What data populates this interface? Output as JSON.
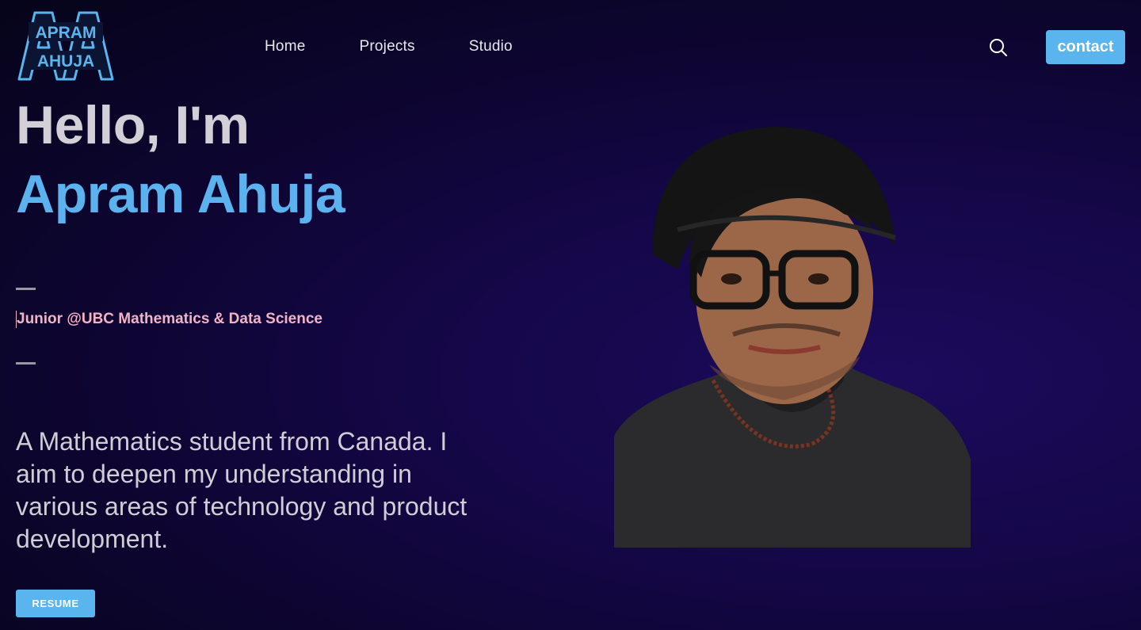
{
  "logo": {
    "line1": "APRAM",
    "line2": "AHUJA",
    "color": "#5ab4ee"
  },
  "nav": {
    "items": [
      {
        "label": "Home"
      },
      {
        "label": "Projects"
      },
      {
        "label": "Studio"
      }
    ]
  },
  "header": {
    "search_icon": "search-icon",
    "contact_label": "contact"
  },
  "hero": {
    "greeting": "Hello, I'm",
    "name": "Apram Ahuja",
    "subtitle": "Junior @UBC Mathematics & Data Science",
    "bio": "A Mathematics student from Canada. I aim to deepen my understanding in various areas of technology and product development.",
    "resume_label": "RESUME"
  },
  "colors": {
    "accent": "#5ab4ee",
    "subtitle": "#f4b3c5",
    "background": "#150748"
  }
}
